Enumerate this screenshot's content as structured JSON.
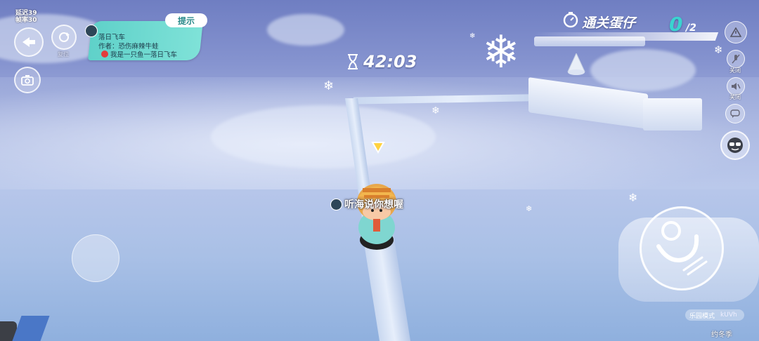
{
  "stats": {
    "latency": "延迟39",
    "fps": "帧率30"
  },
  "left_buttons": {
    "back_icon": "back-arrow-icon",
    "reset_label": "复位",
    "camera_icon": "camera-icon"
  },
  "level_card": {
    "hint_label": "提示",
    "title": "落日飞车",
    "author": "作者：恐伤麻辣牛蛙",
    "desc": "我是一只鱼一落日飞车"
  },
  "timer": {
    "value": "42:03",
    "icon": "hourglass-icon"
  },
  "goal": {
    "title": "通关蛋仔",
    "count": "0",
    "total": "/2",
    "icon": "stopwatch-icon"
  },
  "right_buttons": {
    "mic_label": "关闭",
    "speaker_label": "关闭",
    "warn_icon": "warning-icon",
    "chat_icon": "chat-bubble-icon",
    "emote_icon": "sunglasses-face-icon"
  },
  "player": {
    "name": "听海说你想喔"
  },
  "mode": {
    "label": "乐园模式",
    "code": "kUVh"
  },
  "footer_text": "约冬季"
}
